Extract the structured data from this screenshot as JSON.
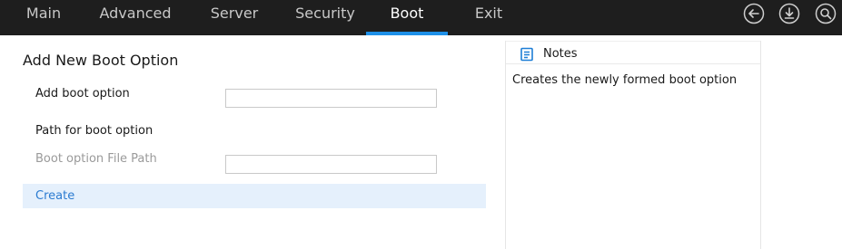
{
  "nav": {
    "tabs": [
      {
        "label": "Main"
      },
      {
        "label": "Advanced"
      },
      {
        "label": "Server"
      },
      {
        "label": "Security"
      },
      {
        "label": "Boot",
        "active": true
      },
      {
        "label": "Exit"
      }
    ],
    "icons": [
      "back-icon",
      "download-icon",
      "search-icon"
    ]
  },
  "form": {
    "title": "Add New Boot Option",
    "add_boot_option_label": "Add boot option",
    "add_boot_option_value": "",
    "path_label": "Path for boot option",
    "file_path_label": "Boot option File Path",
    "file_path_value": "",
    "create_label": "Create"
  },
  "notes": {
    "title": "Notes",
    "text": "Creates the newly formed boot option"
  },
  "colors": {
    "accent": "#1e90e8",
    "topbar": "#1e1e1e",
    "highlight": "#e5f0fc",
    "link": "#2b7bd1"
  }
}
